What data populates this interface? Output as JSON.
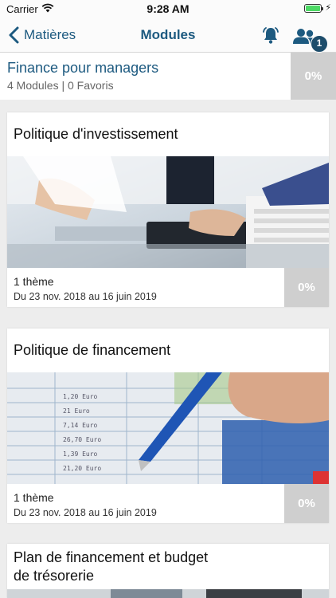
{
  "status_bar": {
    "carrier": "Carrier",
    "time": "9:28 AM",
    "icons": [
      "wifi-icon",
      "battery-icon",
      "charging-icon"
    ]
  },
  "nav": {
    "back_label": "Matières",
    "title": "Modules",
    "notification_count": "1",
    "icons": [
      "chevron-left-icon",
      "bell-icon",
      "users-icon"
    ]
  },
  "course": {
    "title": "Finance pour managers",
    "meta": "4 Modules | 0 Favoris",
    "progress": "0%"
  },
  "modules": [
    {
      "title": "Politique d'investissement",
      "image": "office-desk-photo",
      "themes": "1 thème",
      "dates": "Du 23 nov. 2018 au 16 juin 2019",
      "progress": "0%"
    },
    {
      "title": "Politique de financement",
      "image": "spreadsheet-pen-photo",
      "themes": "1 thème",
      "dates": "Du 23 nov. 2018 au 16 juin 2019",
      "progress": "0%"
    },
    {
      "title_line1": "Plan de financement et budget",
      "title_line2": "de trésorerie",
      "image": "calculator-photo"
    }
  ],
  "colors": {
    "accent": "#1d5a80",
    "badge": "#1d4d6b",
    "progress_bg": "#cfcfcf",
    "page_bg": "#ededed"
  }
}
